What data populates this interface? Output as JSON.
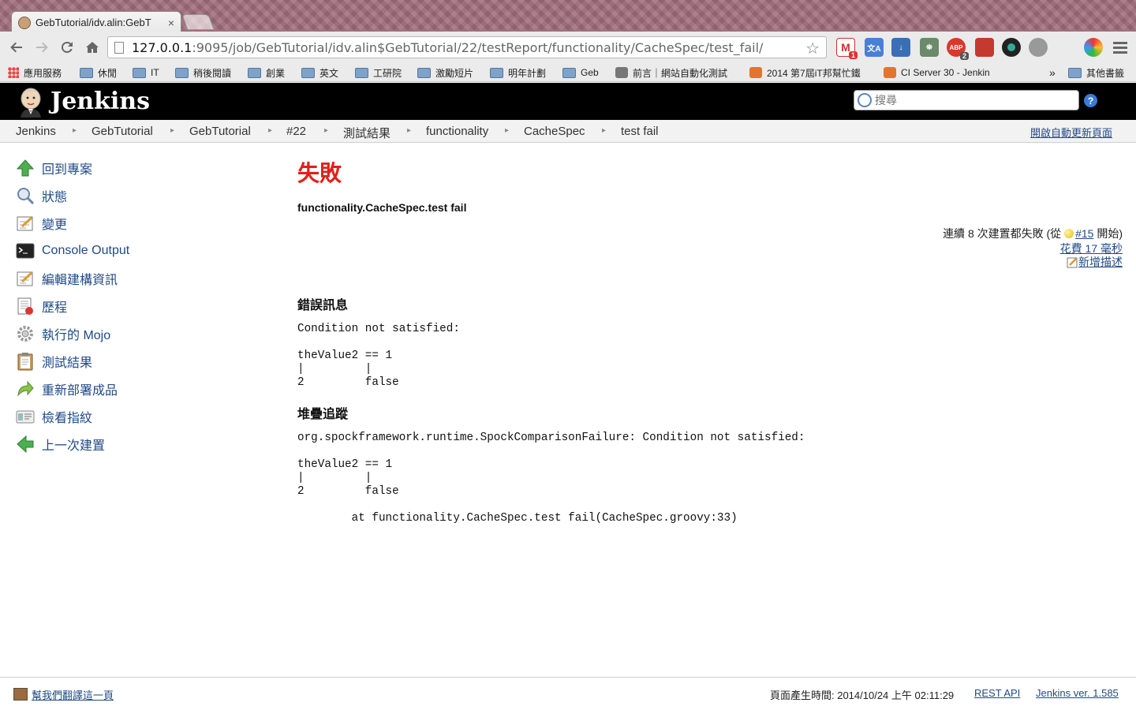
{
  "browser": {
    "tab_title": "GebTutorial/idv.alin:GebT",
    "tab_close": "×",
    "url_host": "127.0.0.1",
    "url_rest": ":9095/job/GebTutorial/idv.alin$GebTutorial/22/testReport/functionality/CacheSpec/test_fail/",
    "ext_gmail_badge": "1",
    "ext_abp_label": "ABP",
    "ext_abp_badge": "2",
    "bookmarks": [
      "應用服務",
      "休閒",
      "IT",
      "稍後閱讀",
      "創業",
      "英文",
      "工研院",
      "激勵短片",
      "明年計劃",
      "Geb",
      "前言｜網站自動化測試",
      "2014 第7屆iT邦幫忙鐵",
      "CI Server 30 - Jenkin"
    ],
    "bookmarks_overflow": "»",
    "bookmarks_other": "其他書籤"
  },
  "header": {
    "title": "Jenkins",
    "search_placeholder": "搜尋",
    "help": "?"
  },
  "breadcrumbs": [
    "Jenkins",
    "GebTutorial",
    "GebTutorial",
    "#22",
    "測試結果",
    "functionality",
    "CacheSpec",
    "test fail"
  ],
  "autorefresh": "開啟自動更新頁面",
  "sidebar": [
    "回到專案",
    "狀態",
    "變更",
    "Console Output",
    "編輯建構資訊",
    "歷程",
    "執行的 Mojo",
    "測試結果",
    "重新部署成品",
    "檢看指紋",
    "上一次建置"
  ],
  "main": {
    "status": "失敗",
    "test_name": "functionality.CacheSpec.test fail",
    "fail_prefix": "連續 8 次建置都失敗 (從 ",
    "fail_build": "#15",
    "fail_suffix": " 開始)",
    "duration": "花費 17 毫秒",
    "add_description": "新增描述",
    "error_heading": "錯誤訊息",
    "error_message": "Condition not satisfied:\n\ntheValue2 == 1\n|         |\n2         false",
    "stack_heading": "堆疊追蹤",
    "stack_trace": "org.spockframework.runtime.SpockComparisonFailure: Condition not satisfied:\n\ntheValue2 == 1\n|         |\n2         false\n\n\tat functionality.CacheSpec.test fail(CacheSpec.groovy:33)"
  },
  "footer": {
    "translate": "幫我們翻譯這一頁",
    "generated": "頁面產生時間: 2014/10/24 上午 02:11:29",
    "rest_api": "REST API",
    "version": "Jenkins ver. 1.585"
  }
}
